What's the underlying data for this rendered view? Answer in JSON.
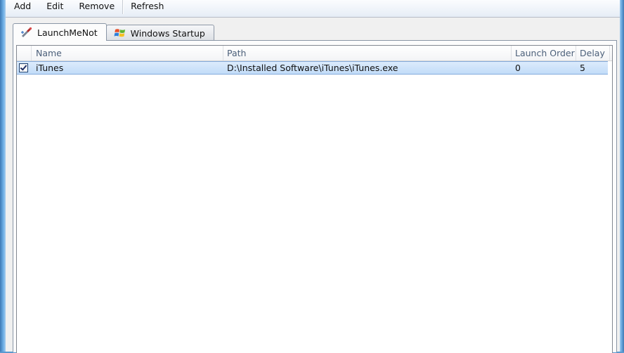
{
  "menu": {
    "items": [
      "Add",
      "Edit",
      "Remove",
      "Refresh"
    ]
  },
  "tabs": [
    {
      "label": "LaunchMeNot",
      "icon": "launchmenot-icon",
      "active": true
    },
    {
      "label": "Windows Startup",
      "icon": "windows-logo-icon",
      "active": false
    }
  ],
  "list": {
    "columns": {
      "name": "Name",
      "path": "Path",
      "launch_order": "Launch Order",
      "delay": "Delay"
    },
    "rows": [
      {
        "checked": true,
        "name": "iTunes",
        "path": "D:\\Installed Software\\iTunes\\iTunes.exe",
        "launch_order": "0",
        "delay": "5"
      }
    ]
  },
  "colors": {
    "selection_fill": "#c8dff9",
    "selection_border": "#84acdd",
    "header_text": "#4c607a",
    "window_frame": "#5a9ad0"
  }
}
